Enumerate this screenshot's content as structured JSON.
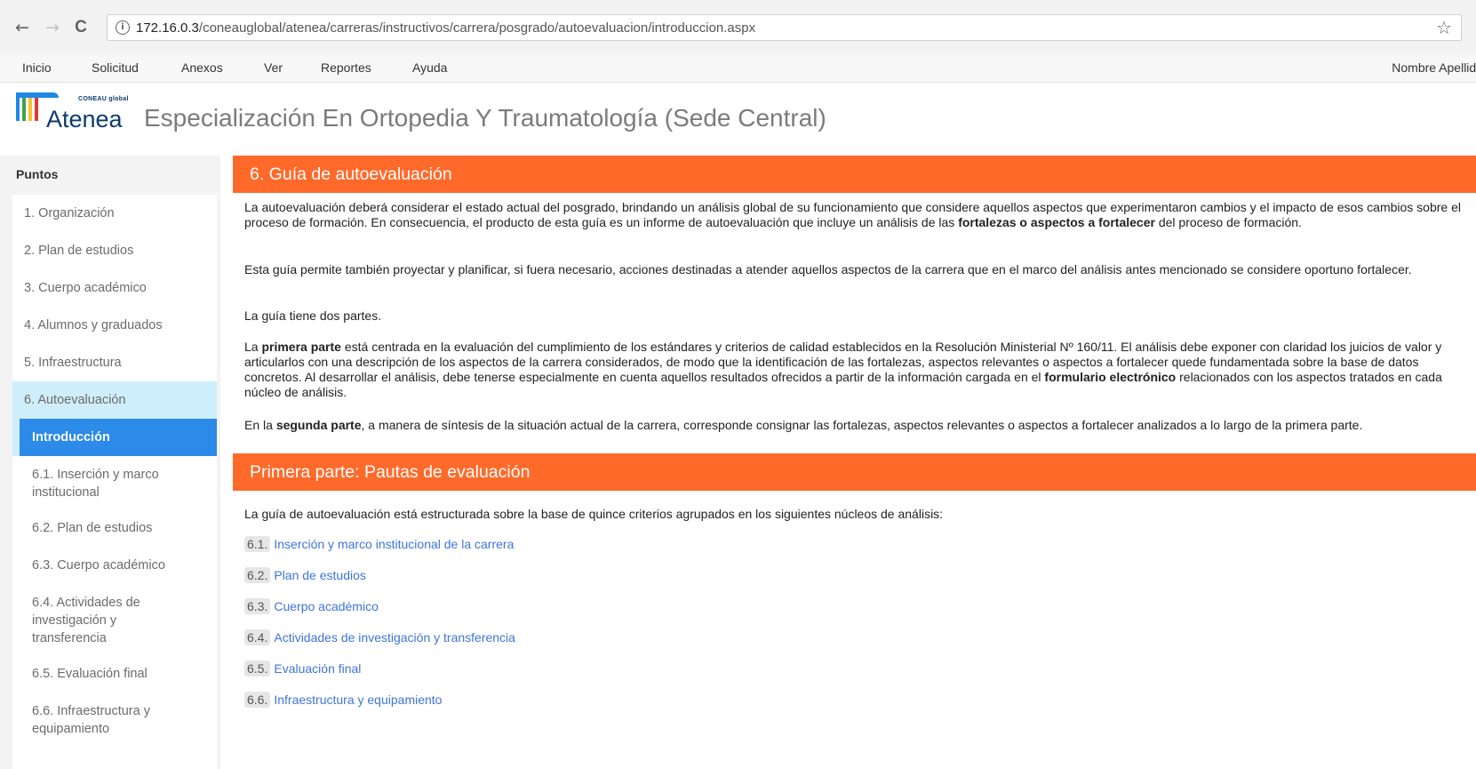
{
  "browser": {
    "back_glyph": "←",
    "forward_glyph": "→",
    "reload_glyph": "C",
    "url_host": "172.16.0.3",
    "url_path": "/coneauglobal/atenea/carreras/instructivos/carrera/posgrado/autoevaluacion/introduccion.aspx",
    "info_glyph": "i",
    "star_glyph": "☆"
  },
  "menu": {
    "items": [
      "Inicio",
      "Solicitud",
      "Anexos",
      "Ver",
      "Reportes",
      "Ayuda"
    ],
    "user": "Nombre Apellido"
  },
  "header": {
    "brand": "Atenea",
    "brand_tag": "CONEAU global",
    "program_title": "Especialización En Ortopedia Y Traumatología (Sede Central)",
    "logo_colors": [
      "#1e88e5",
      "#43a047",
      "#fbc02d",
      "#e53935"
    ]
  },
  "sidebar": {
    "title": "Puntos",
    "items": [
      "1. Organización",
      "2. Plan de estudios",
      "3. Cuerpo académico",
      "4. Alumnos y graduados",
      "5. Infraestructura",
      "6. Autoevaluación",
      "Introducción",
      "6.1. Inserción y marco institucional",
      "6.2. Plan de estudios",
      "6.3. Cuerpo académico",
      "6.4. Actividades de investigación y transferencia",
      "6.5. Evaluación final",
      "6.6. Infraestructura y equipamiento"
    ]
  },
  "main": {
    "section1_title": "6. Guía de autoevaluación",
    "p1_a": "La autoevaluación deberá considerar el estado actual del posgrado, brindando un análisis global de su funcionamiento que considere aquellos aspectos que experimentaron cambios y el impacto de esos cambios sobre el proceso de formación. En consecuencia, el producto de esta guía es un informe de autoevaluación que incluye un análisis de las ",
    "p1_b": "fortalezas o aspectos a fortalecer",
    "p1_c": " del proceso de formación.",
    "p2": "Esta guía permite también proyectar y planificar, si fuera necesario, acciones destinadas a atender aquellos aspectos de la carrera que en el marco del análisis antes mencionado se considere oportuno fortalecer.",
    "p3": "La guía tiene dos partes.",
    "p4_a": "La ",
    "p4_b": "primera parte",
    "p4_c": " está centrada en la evaluación del cumplimiento de los estándares y criterios de calidad establecidos en la Resolución Ministerial Nº 160/11. El análisis debe exponer con claridad los juicios de valor y articularlos con una descripción de los aspectos de la carrera considerados, de modo que la identificación de las fortalezas, aspectos relevantes o aspectos a fortalecer quede fundamentada sobre la base de datos concretos. Al desarrollar el análisis, debe tenerse especialmente en cuenta aquellos resultados ofrecidos a partir de la información cargada en el ",
    "p4_d": "formulario electrónico",
    "p4_e": " relacionados con los aspectos tratados en cada núcleo de análisis.",
    "p5_a": "En la ",
    "p5_b": "segunda parte",
    "p5_c": ", a manera de síntesis de la situación actual de la carrera, corresponde consignar las fortalezas, aspectos relevantes o aspectos a fortalecer analizados a lo largo de la primera parte.",
    "section2_title": "Primera parte: Pautas de evaluación",
    "p6": "La guía de autoevaluación está estructurada sobre la base de quince criterios agrupados en los siguientes núcleos de análisis:",
    "criteria": [
      {
        "num": "6.1.",
        "label": "Inserción y marco institucional de la carrera"
      },
      {
        "num": "6.2.",
        "label": "Plan de estudios"
      },
      {
        "num": "6.3.",
        "label": "Cuerpo académico"
      },
      {
        "num": "6.4.",
        "label": "Actividades de investigación y transferencia"
      },
      {
        "num": "6.5.",
        "label": "Evaluación final"
      },
      {
        "num": "6.6.",
        "label": "Infraestructura y equipamiento"
      }
    ]
  },
  "colors": {
    "accent_orange": "#ff6a2b",
    "selected_blue": "#2c8ae8",
    "active_parent": "#cfeefb",
    "link_blue": "#3f74d9"
  }
}
